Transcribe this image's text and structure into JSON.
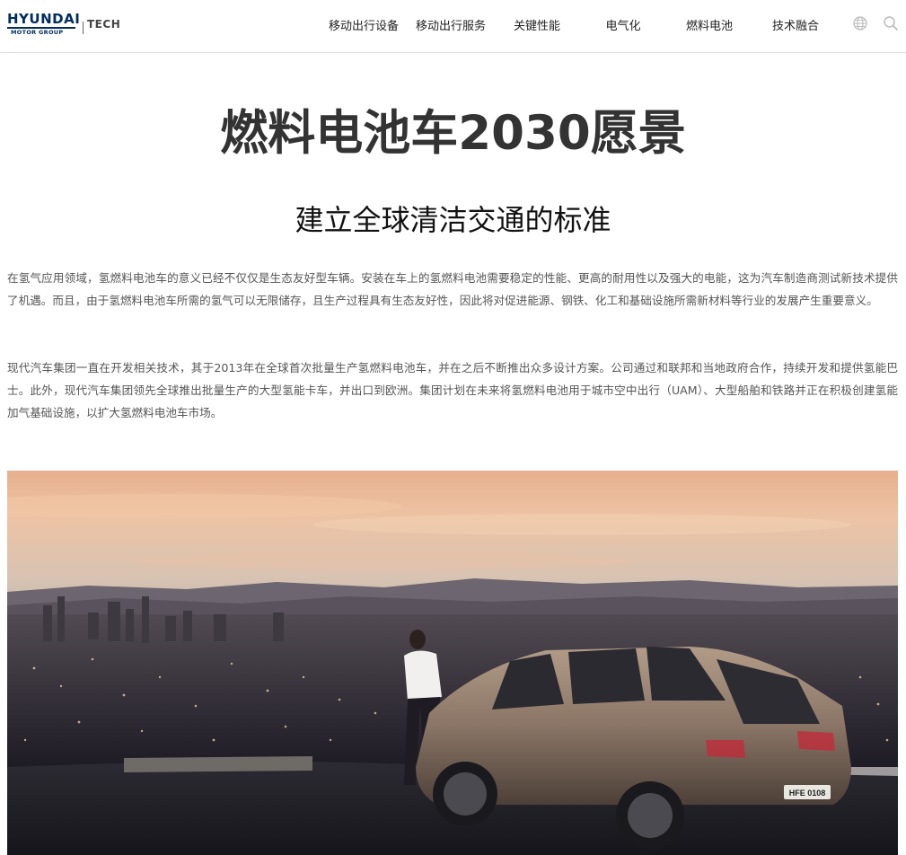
{
  "header": {
    "logo_text": "HYUNDAI",
    "logo_sub": "MOTOR GROUP",
    "logo_tech": "TECH",
    "nav": [
      {
        "label": "移动出行设备"
      },
      {
        "label": "移动出行服务"
      },
      {
        "label": "关键性能"
      },
      {
        "label": "电气化"
      },
      {
        "label": "燃料电池"
      },
      {
        "label": "技术融合"
      }
    ],
    "icons": [
      "globe-icon",
      "search-icon"
    ]
  },
  "main": {
    "title": "燃料电池车2030愿景",
    "subtitle": "建立全球清洁交通的标准",
    "paragraphs": [
      "在氢气应用领域，氢燃料电池车的意义已经不仅仅是生态友好型车辆。安装在车上的氢燃料电池需要稳定的性能、更高的耐用性以及强大的电能，这为汽车制造商测试新技术提供了机遇。而且，由于氢燃料电池车所需的氢气可以无限储存，且生产过程具有生态友好性，因此将对促进能源、钢铁、化工和基础设施所需新材料等行业的发展产生重要意义。",
      "现代汽车集团一直在开发相关技术，其于2013年在全球首次批量生产氢燃料电池车，并在之后不断推出众多设计方案。公司通过和联邦和当地政府合作，持续开发和提供氢能巴士。此外，现代汽车集团领先全球推出批量生产的大型氢能卡车，并出口到欧洲。集团计划在未来将氢燃料电池用于城市空中出行（UAM）、大型船舶和铁路并正在积极创建氢能加气基础设施，以扩大氢燃料电池车市场。"
    ],
    "hero_plate": "HFE 0108"
  },
  "colors": {
    "brand": "#002c5f",
    "text": "#333333",
    "body_text": "#555555",
    "divider": "#e2e2e2"
  }
}
